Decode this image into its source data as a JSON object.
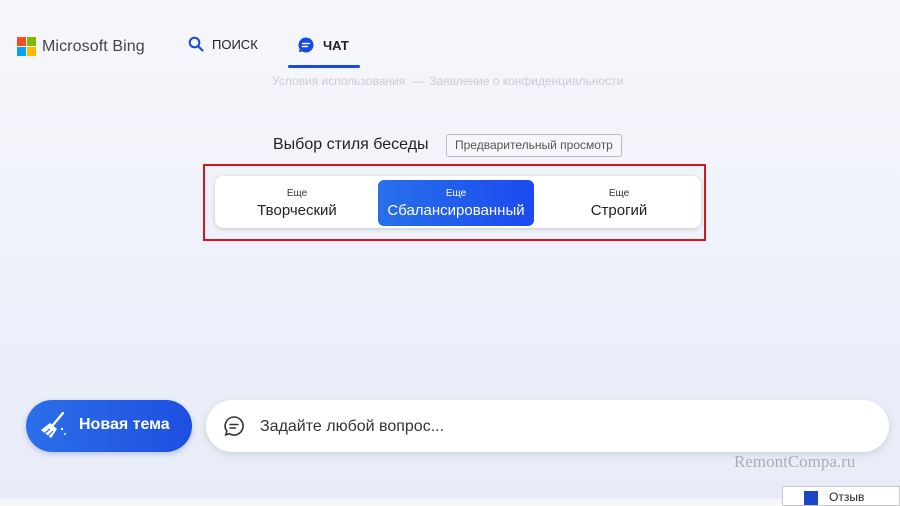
{
  "header": {
    "logo_text": "Microsoft Bing",
    "nav": {
      "search_label": "ПОИСК",
      "chat_label": "ЧАТ"
    }
  },
  "terms": {
    "terms_link": "Условия использования",
    "privacy_link": "Заявление о конфиденциальности"
  },
  "tone": {
    "title": "Выбор стиля беседы",
    "preview_badge": "Предварительный просмотр",
    "options": [
      {
        "small": "Еще",
        "label": "Творческий"
      },
      {
        "small": "Еще",
        "label": "Сбалансированный",
        "selected": true
      },
      {
        "small": "Еще",
        "label": "Строгий"
      }
    ]
  },
  "bottom": {
    "new_topic_label": "Новая тема",
    "ask_placeholder": "Задайте любой вопрос...",
    "feedback_label": "Отзыв"
  },
  "watermark": "RemontCompa.ru",
  "colors": {
    "accent": "#174ae4",
    "highlight_border": "#d8151f",
    "ms_red": "#f25022",
    "ms_green": "#7fba00",
    "ms_blue": "#00a4ef",
    "ms_yellow": "#ffb900"
  }
}
